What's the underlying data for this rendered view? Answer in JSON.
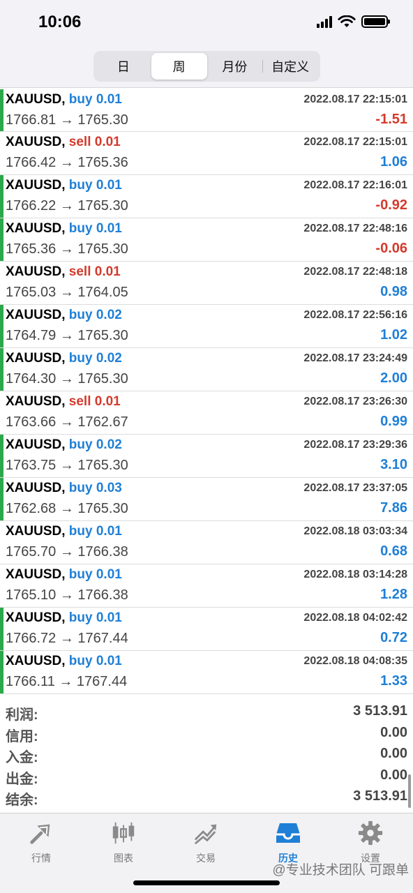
{
  "status": {
    "time": "10:06"
  },
  "segments": [
    {
      "label": "日",
      "active": false
    },
    {
      "label": "周",
      "active": true
    },
    {
      "label": "月份",
      "active": false
    },
    {
      "label": "自定义",
      "active": false
    }
  ],
  "colors": {
    "buy": "#1f7fd6",
    "sell": "#d33a2c",
    "accent": "#2ba84a",
    "active_tab": "#1f7fd6"
  },
  "deals": [
    {
      "symbol": "XAUUSD,",
      "side": "buy 0.01",
      "type": "buy",
      "prices": "1766.81 → 1765.30",
      "time": "2022.08.17 22:15:01",
      "profit": "-1.51",
      "accent": true
    },
    {
      "symbol": "XAUUSD,",
      "side": "sell 0.01",
      "type": "sell",
      "prices": "1766.42 → 1765.36",
      "time": "2022.08.17 22:15:01",
      "profit": "1.06",
      "accent": false
    },
    {
      "symbol": "XAUUSD,",
      "side": "buy 0.01",
      "type": "buy",
      "prices": "1766.22 → 1765.30",
      "time": "2022.08.17 22:16:01",
      "profit": "-0.92",
      "accent": true
    },
    {
      "symbol": "XAUUSD,",
      "side": "buy 0.01",
      "type": "buy",
      "prices": "1765.36 → 1765.30",
      "time": "2022.08.17 22:48:16",
      "profit": "-0.06",
      "accent": true
    },
    {
      "symbol": "XAUUSD,",
      "side": "sell 0.01",
      "type": "sell",
      "prices": "1765.03 → 1764.05",
      "time": "2022.08.17 22:48:18",
      "profit": "0.98",
      "accent": false
    },
    {
      "symbol": "XAUUSD,",
      "side": "buy 0.02",
      "type": "buy",
      "prices": "1764.79 → 1765.30",
      "time": "2022.08.17 22:56:16",
      "profit": "1.02",
      "accent": true
    },
    {
      "symbol": "XAUUSD,",
      "side": "buy 0.02",
      "type": "buy",
      "prices": "1764.30 → 1765.30",
      "time": "2022.08.17 23:24:49",
      "profit": "2.00",
      "accent": true
    },
    {
      "symbol": "XAUUSD,",
      "side": "sell 0.01",
      "type": "sell",
      "prices": "1763.66 → 1762.67",
      "time": "2022.08.17 23:26:30",
      "profit": "0.99",
      "accent": false
    },
    {
      "symbol": "XAUUSD,",
      "side": "buy 0.02",
      "type": "buy",
      "prices": "1763.75 → 1765.30",
      "time": "2022.08.17 23:29:36",
      "profit": "3.10",
      "accent": true
    },
    {
      "symbol": "XAUUSD,",
      "side": "buy 0.03",
      "type": "buy",
      "prices": "1762.68 → 1765.30",
      "time": "2022.08.17 23:37:05",
      "profit": "7.86",
      "accent": true
    },
    {
      "symbol": "XAUUSD,",
      "side": "buy 0.01",
      "type": "buy",
      "prices": "1765.70 → 1766.38",
      "time": "2022.08.18 03:03:34",
      "profit": "0.68",
      "accent": false
    },
    {
      "symbol": "XAUUSD,",
      "side": "buy 0.01",
      "type": "buy",
      "prices": "1765.10 → 1766.38",
      "time": "2022.08.18 03:14:28",
      "profit": "1.28",
      "accent": false
    },
    {
      "symbol": "XAUUSD,",
      "side": "buy 0.01",
      "type": "buy",
      "prices": "1766.72 → 1767.44",
      "time": "2022.08.18 04:02:42",
      "profit": "0.72",
      "accent": true
    },
    {
      "symbol": "XAUUSD,",
      "side": "buy 0.01",
      "type": "buy",
      "prices": "1766.11 → 1767.44",
      "time": "2022.08.18 04:08:35",
      "profit": "1.33",
      "accent": true
    }
  ],
  "summary": [
    {
      "label": "利润:",
      "value": "3 513.91"
    },
    {
      "label": "信用:",
      "value": "0.00"
    },
    {
      "label": "入金:",
      "value": "0.00"
    },
    {
      "label": "出金:",
      "value": "0.00"
    },
    {
      "label": "结余:",
      "value": "3 513.91"
    }
  ],
  "tabs": [
    {
      "label": "行情",
      "icon": "quotes-icon",
      "active": false
    },
    {
      "label": "图表",
      "icon": "chart-icon",
      "active": false
    },
    {
      "label": "交易",
      "icon": "trade-icon",
      "active": false
    },
    {
      "label": "历史",
      "icon": "history-icon",
      "active": true
    },
    {
      "label": "设置",
      "icon": "settings-icon",
      "active": false
    }
  ],
  "watermark": "@专业技术团队 可跟单"
}
